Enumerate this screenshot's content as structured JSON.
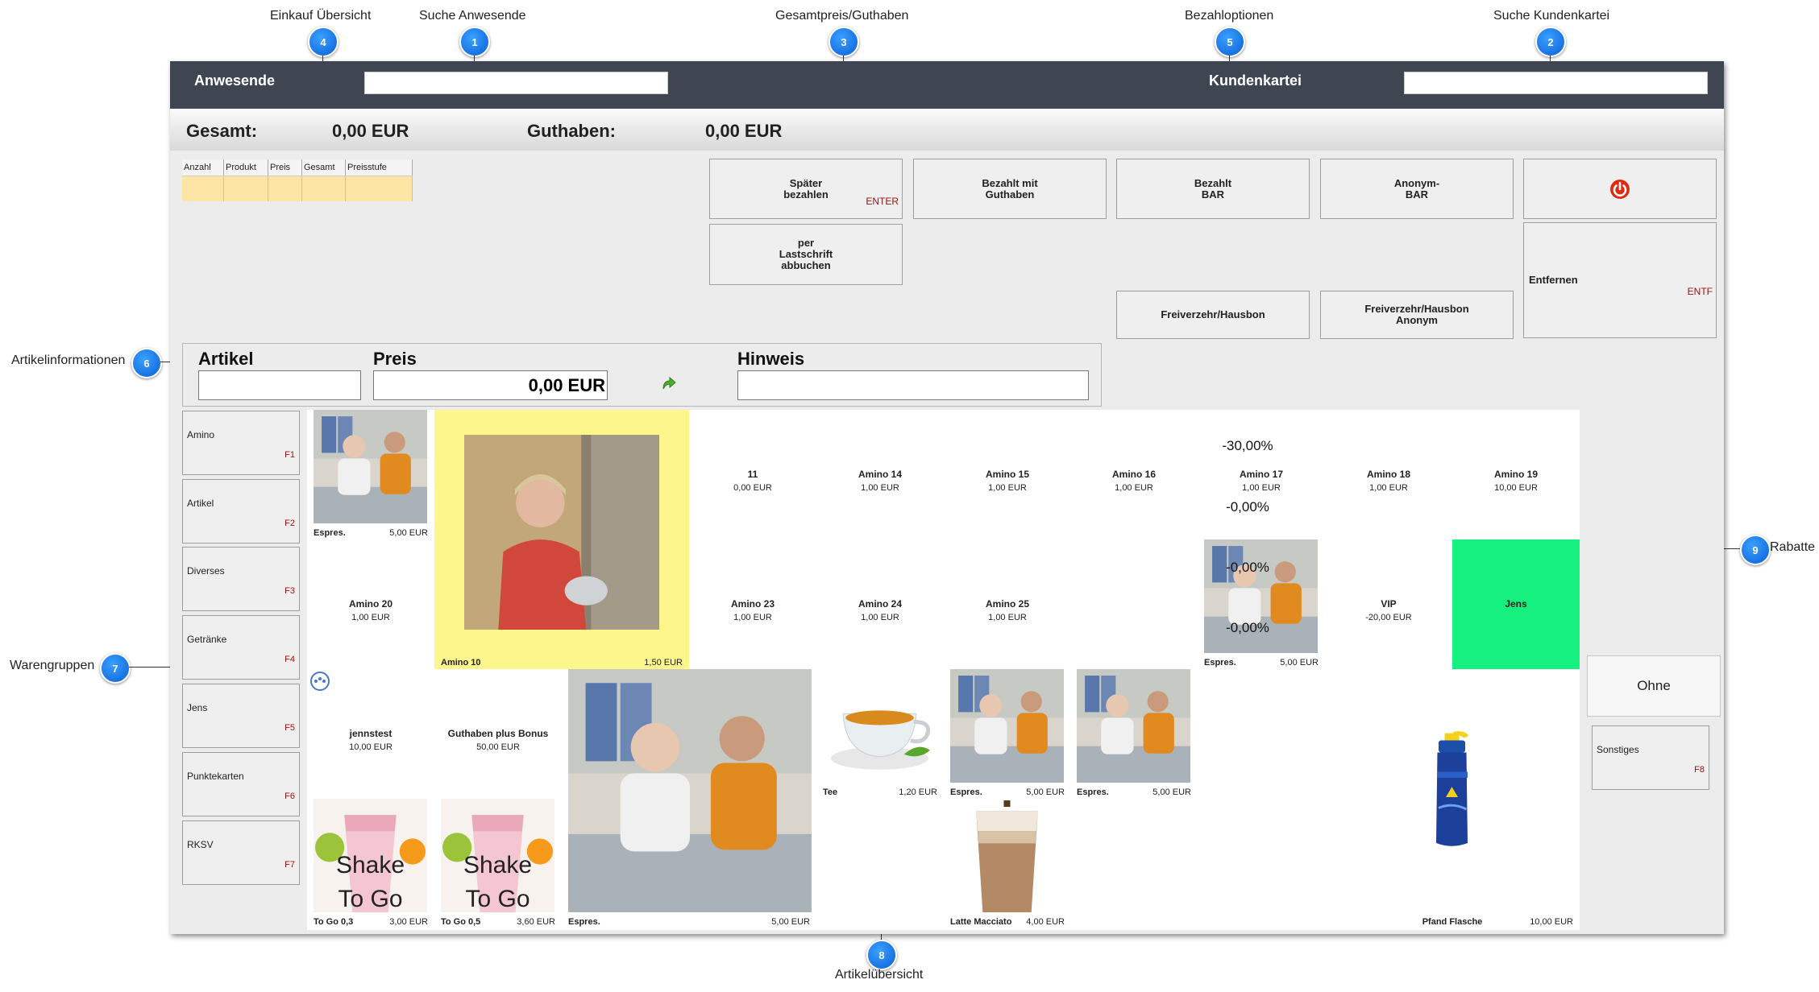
{
  "annotations": [
    {
      "num": "1",
      "label": "Suche Anwesende"
    },
    {
      "num": "2",
      "label": "Suche Kundenkartei"
    },
    {
      "num": "3",
      "label": "Gesamtpreis/Guthaben"
    },
    {
      "num": "4",
      "label": "Einkauf Übersicht"
    },
    {
      "num": "5",
      "label": "Bezahloptionen"
    },
    {
      "num": "6",
      "label": "Artikelinformationen"
    },
    {
      "num": "7",
      "label": "Warengruppen"
    },
    {
      "num": "8",
      "label": "Artikelübersicht"
    },
    {
      "num": "9",
      "label": "Rabatte"
    }
  ],
  "header": {
    "attendees_label": "Anwesende",
    "attendees_value": "",
    "customer_label": "Kundenkartei",
    "customer_value": ""
  },
  "totals": {
    "total_label": "Gesamt:",
    "total_value": "0,00 EUR",
    "credit_label": "Guthaben:",
    "credit_value": "0,00 EUR"
  },
  "cart": {
    "columns": [
      "Anzahl",
      "Produkt",
      "Preis",
      "Gesamt",
      "Preisstufe"
    ]
  },
  "payment": {
    "later_l1": "Später",
    "later_l2": "bezahlen",
    "later_key": "ENTER",
    "credit_l1": "Bezahlt mit",
    "credit_l2": "Guthaben",
    "cash_l1": "Bezahlt",
    "cash_l2": "BAR",
    "anon_l1": "Anonym-",
    "anon_l2": "BAR",
    "debit_l1": "per",
    "debit_l2": "Lastschrift",
    "debit_l3": "abbuchen",
    "free": "Freiverzehr/Hausbon",
    "free_anon_l1": "Freiverzehr/Hausbon",
    "free_anon_l2": "Anonym",
    "remove": "Entfernen",
    "remove_key": "ENTF",
    "power_icon": "power-icon"
  },
  "article_info": {
    "article_label": "Artikel",
    "article_value": "",
    "price_label": "Preis",
    "price_value": "0,00 EUR",
    "hint_label": "Hinweis",
    "hint_value": ""
  },
  "groups": [
    {
      "name": "Amino",
      "key": "F1"
    },
    {
      "name": "Artikel",
      "key": "F2"
    },
    {
      "name": "Diverses",
      "key": "F3"
    },
    {
      "name": "Getränke",
      "key": "F4"
    },
    {
      "name": "Jens",
      "key": "F5"
    },
    {
      "name": "Punktekarten",
      "key": "F6"
    },
    {
      "name": "RKSV",
      "key": "F7"
    }
  ],
  "products": {
    "espres_1": {
      "name": "Espres.",
      "price": "5,00 EUR"
    },
    "amino10": {
      "name": "Amino 10",
      "price": "1,50 EUR"
    },
    "p11": {
      "name": "11",
      "price": "0,00 EUR"
    },
    "amino14": {
      "name": "Amino 14",
      "price": "1,00 EUR"
    },
    "amino15": {
      "name": "Amino 15",
      "price": "1,00 EUR"
    },
    "amino16": {
      "name": "Amino 16",
      "price": "1,00 EUR"
    },
    "amino17": {
      "name": "Amino 17",
      "price": "1,00 EUR"
    },
    "amino18": {
      "name": "Amino 18",
      "price": "1,00 EUR"
    },
    "amino19": {
      "name": "Amino 19",
      "price": "10,00 EUR"
    },
    "amino20": {
      "name": "Amino 20",
      "price": "1,00 EUR"
    },
    "amino23": {
      "name": "Amino 23",
      "price": "1,00 EUR"
    },
    "amino24": {
      "name": "Amino 24",
      "price": "1,00 EUR"
    },
    "amino25": {
      "name": "Amino 25",
      "price": "1,00 EUR"
    },
    "espres_2": {
      "name": "Espres.",
      "price": "5,00 EUR"
    },
    "vip": {
      "name": "VIP",
      "price": "-20,00 EUR"
    },
    "jens": {
      "name": "Jens"
    },
    "jennstest": {
      "name": "jennstest",
      "price": "10,00 EUR"
    },
    "guthaben": {
      "name": "Guthaben plus Bonus",
      "price": "50,00 EUR"
    },
    "espres_big": {
      "name": "Espres.",
      "price": "5,00 EUR"
    },
    "tee": {
      "name": "Tee",
      "price": "1,20 EUR"
    },
    "espres_3": {
      "name": "Espres.",
      "price": "5,00 EUR"
    },
    "espres_4": {
      "name": "Espres.",
      "price": "5,00 EUR"
    },
    "togo03": {
      "name": "To Go 0,3",
      "price": "3,00 EUR",
      "caption_l1": "Shake",
      "caption_l2": "To Go"
    },
    "togo05": {
      "name": "To Go 0,5",
      "price": "3,60 EUR",
      "caption_l1": "Shake",
      "caption_l2": "To Go"
    },
    "latte": {
      "name": "Latte Macciato",
      "price": "4,00 EUR"
    },
    "pfand": {
      "name": "Pfand Flasche",
      "price": "10,00 EUR"
    }
  },
  "discounts": [
    "-30,00%",
    "-0,00%",
    "-0,00%",
    "-0,00%"
  ],
  "discount_none": "Ohne",
  "misc_group": {
    "name": "Sonstiges",
    "key": "F8"
  },
  "colors": {
    "topbar": "#3f4651",
    "cart_row": "#fde5a5",
    "highlight_yellow": "#fdf68c",
    "jens_green": "#16f07e",
    "key_red": "#a01010",
    "badge_blue": "#1a7ef0"
  }
}
